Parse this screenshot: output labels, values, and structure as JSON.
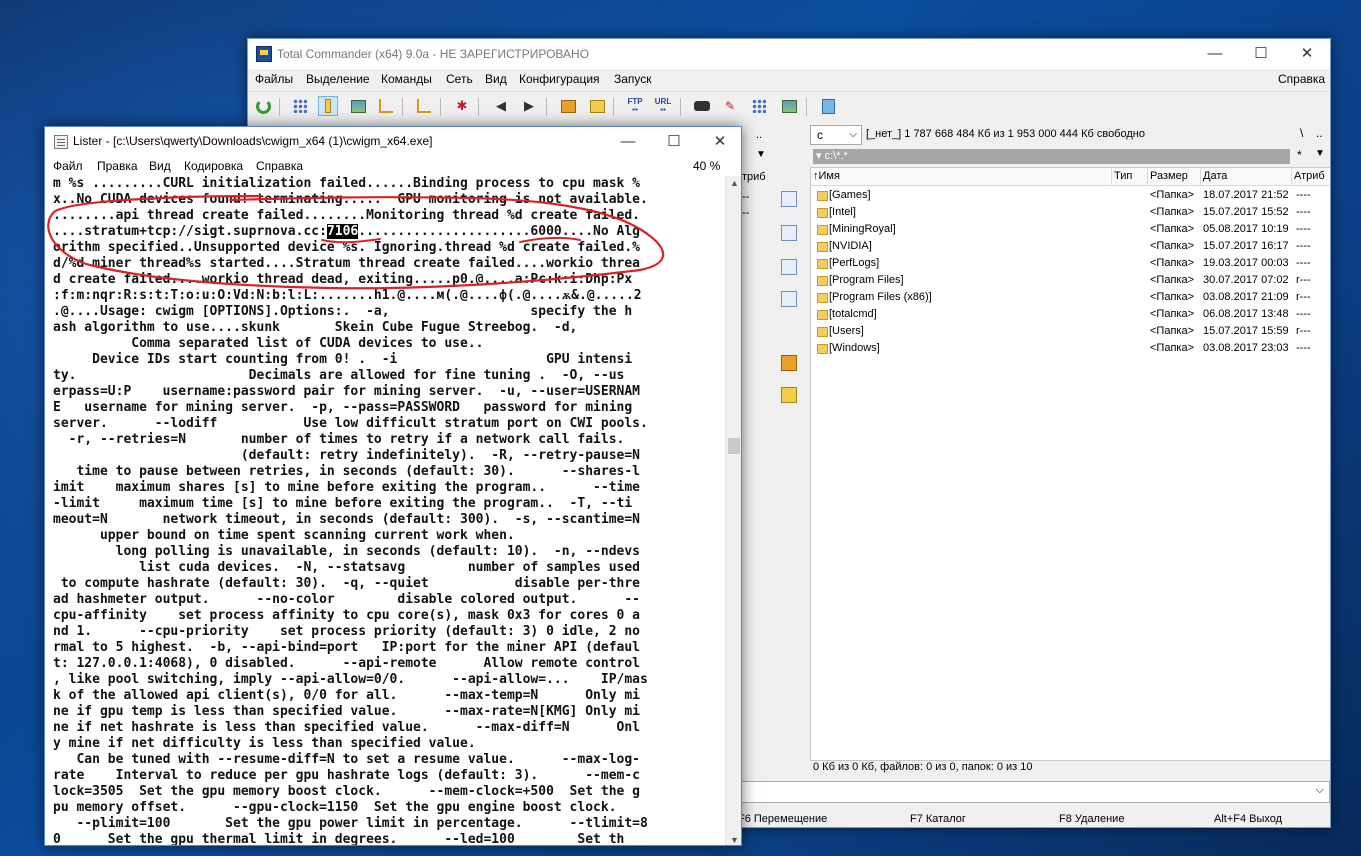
{
  "tc": {
    "title": "Total Commander (x64) 9.0a - НЕ ЗАРЕГИСТРИРОВАНО",
    "menu": [
      "Файлы",
      "Выделение",
      "Команды",
      "Сеть",
      "Вид",
      "Конфигурация",
      "Запуск"
    ],
    "menu_right": "Справка",
    "right_panel": {
      "drive": "c",
      "drive_info": "[_нет_]  1 787 668 484 Кб из 1 953 000 444 Кб свободно",
      "path": "c:\\*.*",
      "columns": [
        "↑Имя",
        "Тип",
        "Размер",
        "Дата",
        "Атриб"
      ],
      "rows": [
        {
          "name": "[Games]",
          "type": "",
          "size": "<Папка>",
          "date": "18.07.2017 21:52",
          "attr": "----"
        },
        {
          "name": "[Intel]",
          "type": "",
          "size": "<Папка>",
          "date": "15.07.2017 15:52",
          "attr": "----"
        },
        {
          "name": "[MiningRoyal]",
          "type": "",
          "size": "<Папка>",
          "date": "05.08.2017 10:19",
          "attr": "----"
        },
        {
          "name": "[NVIDIA]",
          "type": "",
          "size": "<Папка>",
          "date": "15.07.2017 16:17",
          "attr": "----"
        },
        {
          "name": "[PerfLogs]",
          "type": "",
          "size": "<Папка>",
          "date": "19.03.2017 00:03",
          "attr": "----"
        },
        {
          "name": "[Program Files]",
          "type": "",
          "size": "<Папка>",
          "date": "30.07.2017 07:02",
          "attr": "r---"
        },
        {
          "name": "[Program Files (x86)]",
          "type": "",
          "size": "<Папка>",
          "date": "03.08.2017 21:09",
          "attr": "r---"
        },
        {
          "name": "[totalcmd]",
          "type": "",
          "size": "<Папка>",
          "date": "06.08.2017 13:48",
          "attr": "----"
        },
        {
          "name": "[Users]",
          "type": "",
          "size": "<Папка>",
          "date": "15.07.2017 15:59",
          "attr": "r---"
        },
        {
          "name": "[Windows]",
          "type": "",
          "size": "<Папка>",
          "date": "03.08.2017 23:03",
          "attr": "----"
        }
      ],
      "status": "0 Кб из 0 Кб, файлов: 0 из 0, папок: 0 из 10"
    },
    "left_fragments": {
      "col_attr": "триб"
    },
    "fkeys": [
      "F6 Перемещение",
      "F7 Каталог",
      "F8 Удаление",
      "Alt+F4 Выход"
    ]
  },
  "lister": {
    "title": "Lister - [c:\\Users\\qwerty\\Downloads\\cwigm_x64 (1)\\cwigm_x64.exe]",
    "menu": [
      "Файл",
      "Правка",
      "Вид",
      "Кодировка",
      "Справка"
    ],
    "zoom": "40 %",
    "lines": [
      "m %s .........CURL initialization failed......Binding process to cpu mask %",
      "x..No CUDA devices found! terminating.....  GPU monitoring is not available.",
      "........api thread create failed........Monitoring thread %d create failed.",
      "....stratum+tcp://sigt.suprnova.cc:",
      "orithm specified..Unsupported device %s. Ignoring.thread %d create failed.%",
      "d/%d miner thread%s started....Stratum thread create failed....workio threa",
      "d create failed....workio thread dead, exiting.....p0.@....a:Pc:k:i:Dhp:Px",
      ":f:m:nqr:R:s:t:T:o:u:O:Vd:N:b:l:L:.......h1.@....м(.@....ф(.@....ѫ&.@.....2",
      ".@....Usage: cwigm [OPTIONS].Options:.  -a,                  specify the h",
      "ash algorithm to use....skunk       Skein Cube Fugue Streebog.  -d,",
      "          Comma separated list of CUDA devices to use..",
      "     Device IDs start counting from 0! .  -i                   GPU intensi",
      "ty.                      Decimals are allowed for fine tuning .  -O, --us",
      "erpass=U:P    username:password pair for mining server.  -u, --user=USERNAM",
      "E   username for mining server.  -p, --pass=PASSWORD   password for mining",
      "server.      --lodiff           Use low difficult stratum port on CWI pools.",
      "  -r, --retries=N       number of times to retry if a network call fails.",
      "                        (default: retry indefinitely).  -R, --retry-pause=N",
      "   time to pause between retries, in seconds (default: 30).      --shares-l",
      "imit    maximum shares [s] to mine before exiting the program..      --time",
      "-limit     maximum time [s] to mine before exiting the program..  -T, --ti",
      "meout=N       network timeout, in seconds (default: 300).  -s, --scantime=N",
      "      upper bound on time spent scanning current work when.",
      "        long polling is unavailable, in seconds (default: 10).  -n, --ndevs",
      "           list cuda devices.  -N, --statsavg        number of samples used",
      " to compute hashrate (default: 30).  -q, --quiet           disable per-thre",
      "ad hashmeter output.      --no-color        disable colored output.      --",
      "cpu-affinity    set process affinity to cpu core(s), mask 0x3 for cores 0 a",
      "nd 1.      --cpu-priority    set process priority (default: 3) 0 idle, 2 no",
      "rmal to 5 highest.  -b, --api-bind=port   IP:port for the miner API (defaul",
      "t: 127.0.0.1:4068), 0 disabled.      --api-remote      Allow remote control",
      ", like pool switching, imply --api-allow=0/0.      --api-allow=...    IP/mas",
      "k of the allowed api client(s), 0/0 for all.      --max-temp=N      Only mi",
      "ne if gpu temp is less than specified value.      --max-rate=N[KMG] Only mi",
      "ne if net hashrate is less than specified value.      --max-diff=N      Onl",
      "y mine if net difficulty is less than specified value.",
      "   Can be tuned with --resume-diff=N to set a resume value.      --max-log-",
      "rate    Interval to reduce per gpu hashrate logs (default: 3).      --mem-c",
      "lock=3505  Set the gpu memory boost clock.      --mem-clock=+500  Set the g",
      "pu memory offset.      --gpu-clock=1150  Set the gpu engine boost clock.",
      "   --plimit=100       Set the gpu power limit in percentage.      --tlimit=8",
      "0      Set the gpu thermal limit in degrees.      --led=100        Set th"
    ],
    "port_highlight": "7106",
    "line4_tail": "......................6000....No Alg"
  }
}
